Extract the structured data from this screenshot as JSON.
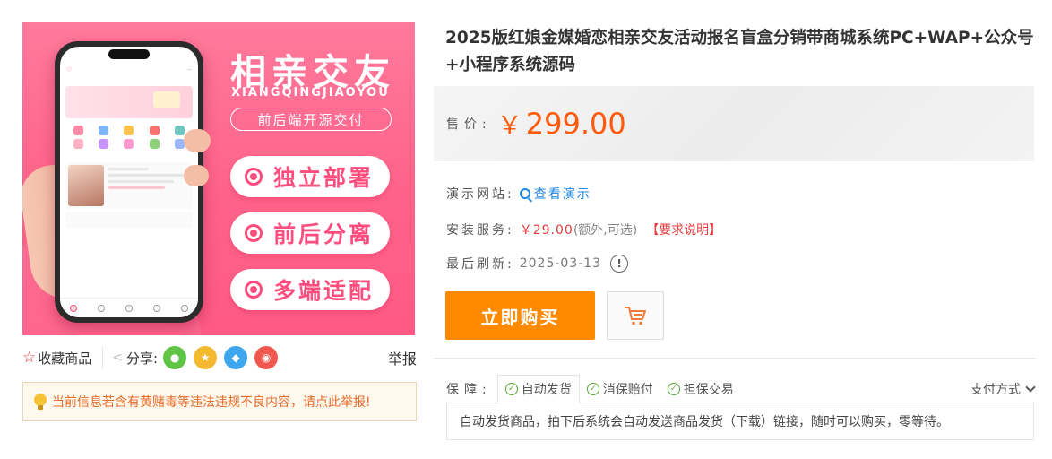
{
  "image": {
    "headline": "相亲交友",
    "pinyin": "XIANGQINGJIAOYOU",
    "tag": "前后端开源交付",
    "features": [
      "独立部署",
      "前后分离",
      "多端适配"
    ]
  },
  "actions": {
    "favorite": "收藏商品",
    "share_label": "分享:",
    "report": "举报"
  },
  "notice": {
    "text": "当前信息若含有黄赌毒等违法违规不良内容，请点此举报!"
  },
  "product": {
    "title": "2025版红娘金媒婚恋相亲交友活动报名盲盒分销带商城系统PC+WAP+公众号+小程序系统源码",
    "price_label": "售价:",
    "currency": "￥",
    "price": "299.00",
    "demo_label": "演示网站:",
    "demo_link": "查看演示",
    "install_label": "安装服务:",
    "install_price": "￥29.00",
    "install_note": "(额外,可选)",
    "install_link": "【要求说明】",
    "refresh_label": "最后刷新:",
    "refresh_date": "2025-03-13",
    "buy_button": "立即购买"
  },
  "guarantee": {
    "label": "保障:",
    "tabs": [
      "自动发货",
      "消保赔付",
      "担保交易"
    ],
    "pay_label": "支付方式",
    "content": "自动发货商品，拍下后系统会自动发送商品发货（下载）链接，随时可以购买，零等待。"
  },
  "colors": {
    "price": "#ff5a0a",
    "buy_button": "#ff8a00",
    "accent_pink": "#ff4d7d",
    "link_blue": "#1b86e4"
  }
}
